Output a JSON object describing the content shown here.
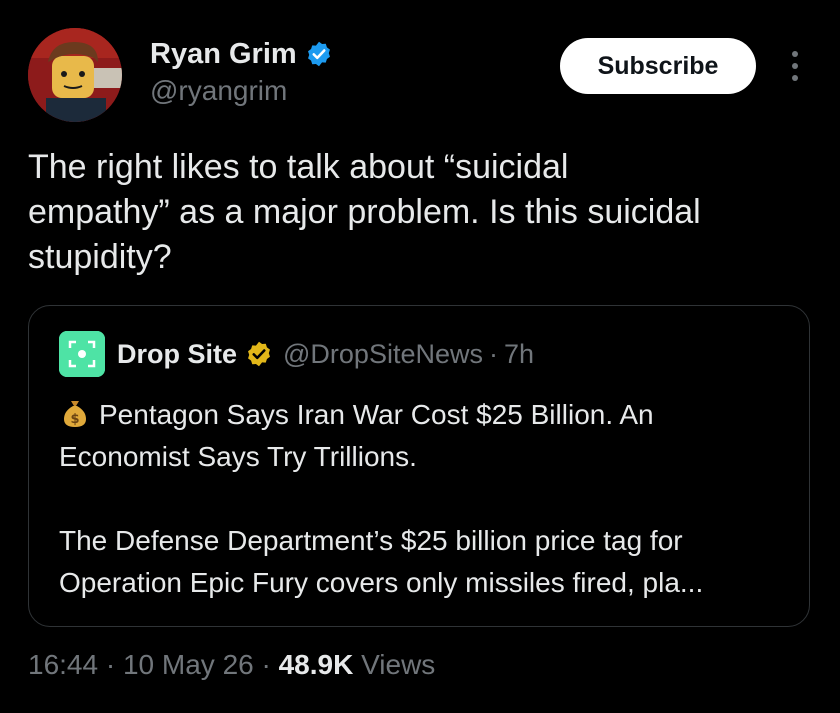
{
  "author": {
    "name": "Ryan Grim",
    "handle": "@ryangrim",
    "verified_color": "#1d9bf0"
  },
  "actions": {
    "subscribe_label": "Subscribe",
    "more_icon": "more-vertical-icon"
  },
  "tweet": {
    "text": "The right likes to talk about “suicidal\nempathy” as a major problem. Is this suicidal\nstupidity?"
  },
  "quote": {
    "name": "Drop Site",
    "handle": "@DropSiteNews",
    "separator": "·",
    "time": "7h",
    "badge_color": "#e2b719",
    "avatar_color": "#4ee3a5",
    "emoji_icon": "money-bag-icon",
    "headline": "Pentagon Says Iran War Cost $25 Billion. An Economist Says Try Trillions.",
    "body": "The Defense Department’s $25 billion price tag for Operation Epic Fury covers only missiles fired, pla..."
  },
  "meta": {
    "time": "16:44",
    "sep1": "·",
    "date": "10 May 26",
    "sep2": "·",
    "views_count": "48.9K",
    "views_label": "Views"
  }
}
